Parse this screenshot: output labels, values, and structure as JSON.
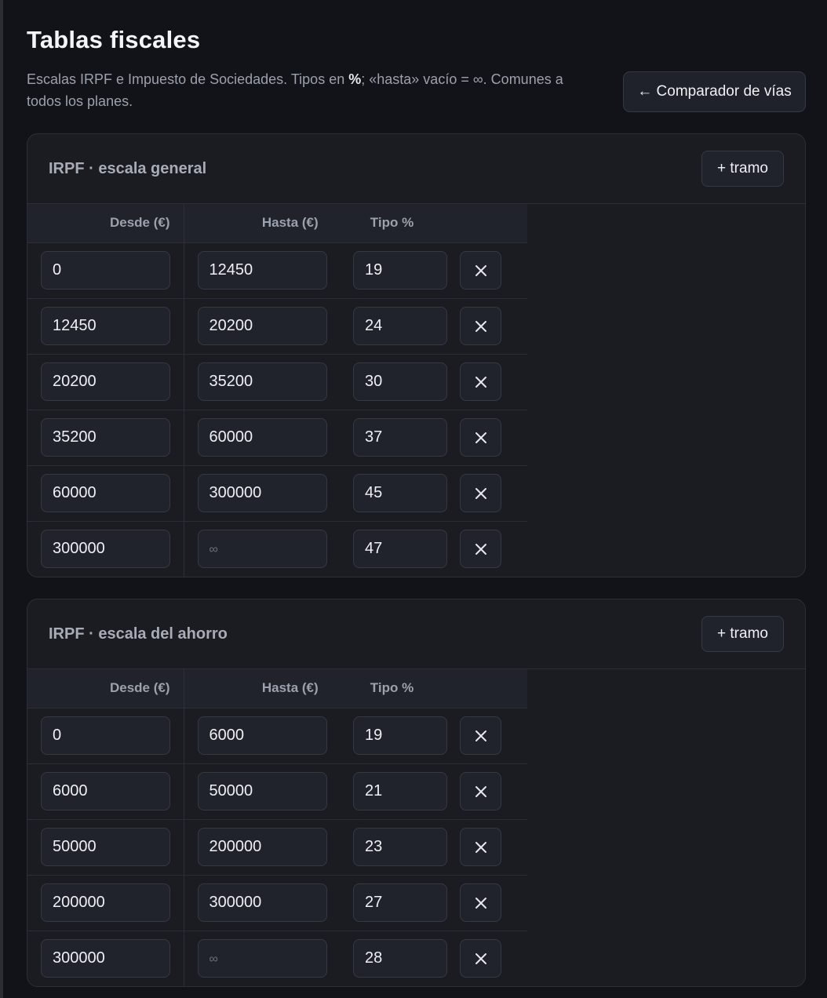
{
  "header": {
    "title": "Tablas fiscales",
    "subtitle_before": "Escalas IRPF e Impuesto de Sociedades. Tipos en ",
    "subtitle_bold": "%",
    "subtitle_after": "; «hasta» vacío = ∞. Comunes a todos los planes.",
    "back_button": "← Comparador de vías"
  },
  "columns": {
    "desde": "Desde (€)",
    "hasta": "Hasta (€)",
    "tipo": "Tipo %"
  },
  "placeholder_hasta": "∞",
  "delete_icon": "close-icon",
  "add_label": "+ tramo",
  "tables": [
    {
      "title": "IRPF · escala general",
      "rows": [
        {
          "desde": "0",
          "hasta": "12450",
          "tipo": "19"
        },
        {
          "desde": "12450",
          "hasta": "20200",
          "tipo": "24"
        },
        {
          "desde": "20200",
          "hasta": "35200",
          "tipo": "30"
        },
        {
          "desde": "35200",
          "hasta": "60000",
          "tipo": "37"
        },
        {
          "desde": "60000",
          "hasta": "300000",
          "tipo": "45"
        },
        {
          "desde": "300000",
          "hasta": "",
          "tipo": "47"
        }
      ]
    },
    {
      "title": "IRPF · escala del ahorro",
      "rows": [
        {
          "desde": "0",
          "hasta": "6000",
          "tipo": "19"
        },
        {
          "desde": "6000",
          "hasta": "50000",
          "tipo": "21"
        },
        {
          "desde": "50000",
          "hasta": "200000",
          "tipo": "23"
        },
        {
          "desde": "200000",
          "hasta": "300000",
          "tipo": "27"
        },
        {
          "desde": "300000",
          "hasta": "",
          "tipo": "28"
        }
      ]
    }
  ]
}
